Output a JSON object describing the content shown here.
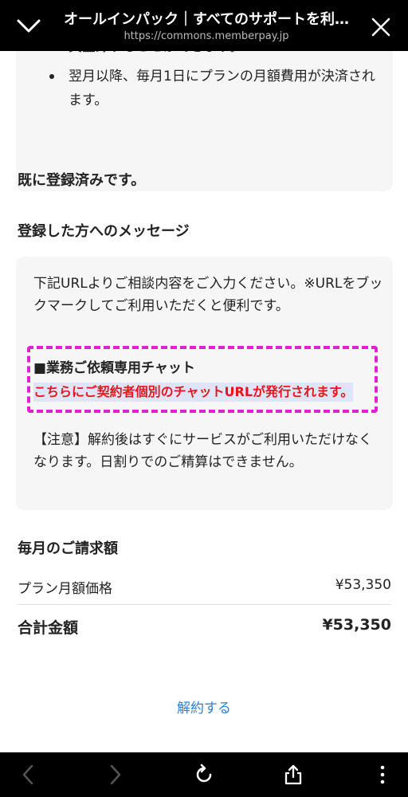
{
  "header": {
    "title": "オールインパック｜すべてのサポートを利…",
    "url": "https://commons.memberpay.jp"
  },
  "info": {
    "continued_text": "員登録することができます。",
    "bullet_text": "翌月以降、毎月1日にプランの月額費用が決済されます。"
  },
  "status": {
    "registered": "既に登録済みです。"
  },
  "message_section": {
    "title": "登録した方へのメッセージ",
    "intro": "下記URLよりご相談内容をご入力ください。※URLをブックマークしてご利用いただくと便利です。",
    "chat_title": "■業務ご依頼専用チャット",
    "chat_link": "こちらにご契約者個別のチャットURLが発行されます。",
    "notice": "【注意】解約後はすぐにサービスがご利用いただけなくなります。日割りでのご精算はできません。"
  },
  "billing": {
    "title": "毎月のご請求額",
    "plan_label": "プラン月額価格",
    "plan_value": "¥53,350",
    "total_label": "合計金額",
    "total_value": "¥53,350"
  },
  "actions": {
    "cancel_label": "解約する"
  },
  "colors": {
    "highlight_border": "#e021d0",
    "link_red": "#e8141c",
    "link_blue": "#2d7fd3"
  }
}
